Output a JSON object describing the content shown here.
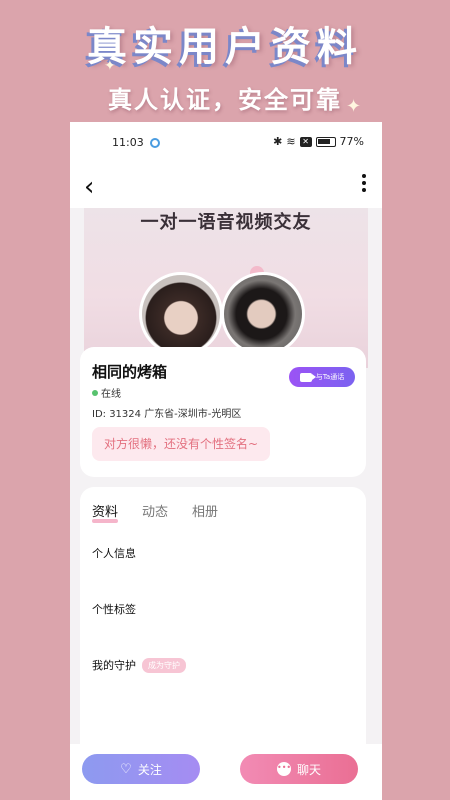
{
  "promo": {
    "title": "真实用户资料",
    "subtitle": "真人认证，安全可靠"
  },
  "statusbar": {
    "time": "11:03",
    "battery": "77%",
    "bluetooth_icon": "✱",
    "wifi_icon": "≋",
    "x_icon": "✕"
  },
  "navbar": {
    "back_icon": "‹"
  },
  "banner": {
    "title": "一对一语音视频交友"
  },
  "profile": {
    "nickname": "相同的烤箱",
    "status": "在线",
    "id_location": "ID:  31324  广东省-深圳市-光明区",
    "call_label": "与Ta通话",
    "signature": "对方很懒，还没有个性签名~"
  },
  "tabs": [
    "资料",
    "动态",
    "相册"
  ],
  "sections": {
    "personal_info": "个人信息",
    "tags": "个性标签",
    "guard": "我的守护",
    "guard_button": "成为守护"
  },
  "actions": {
    "follow": "关注",
    "chat": "聊天",
    "heart_icon": "♡",
    "chat_icon": "•••"
  },
  "colors": {
    "background": "#dba4ac",
    "accent_purple": "#9b53f5",
    "accent_pink": "#ea6f94"
  }
}
